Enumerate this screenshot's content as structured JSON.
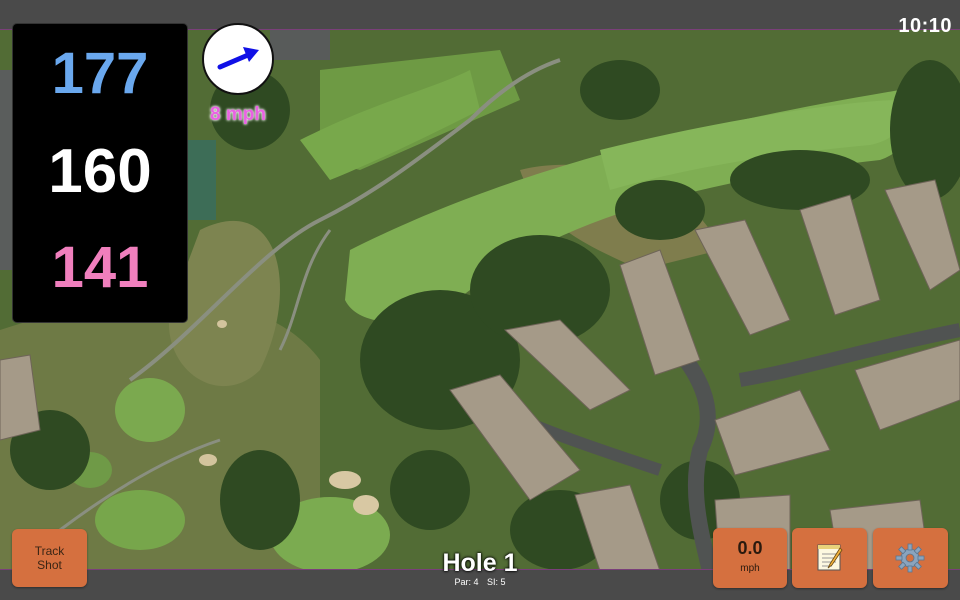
{
  "status_bar": {
    "time": "10:10"
  },
  "distances": {
    "back": "177",
    "middle": "160",
    "front": "141"
  },
  "colors": {
    "back": "#6aa8ee",
    "middle": "#ffffff",
    "front": "#f07fbd",
    "button": "#d5703f",
    "wind_text": "#ea62e3"
  },
  "wind": {
    "speed_label": "8 mph",
    "arrow_icon": "wind-direction-arrow-icon"
  },
  "buttons": {
    "track_shot_line1": "Track",
    "track_shot_line2": "Shot",
    "speed_value": "0.0",
    "speed_unit": "mph",
    "notes_icon": "notepad-icon",
    "settings_icon": "gear-icon"
  },
  "hole": {
    "title": "Hole 1",
    "par": "Par: 4",
    "stroke_index": "SI: 5"
  }
}
